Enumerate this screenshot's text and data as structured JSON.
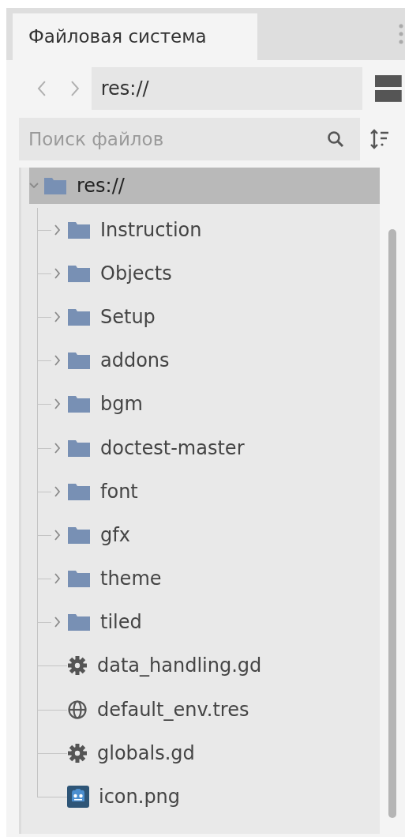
{
  "tabs": [
    {
      "label": "Файловая система",
      "selected": true
    }
  ],
  "path": {
    "value": "res://"
  },
  "search": {
    "placeholder": "Поиск файлов"
  },
  "tree": {
    "label": "res://",
    "kind": "folder",
    "expanded": true,
    "selected": true,
    "children": [
      {
        "label": "Instruction",
        "kind": "folder",
        "expanded": false
      },
      {
        "label": "Objects",
        "kind": "folder",
        "expanded": false
      },
      {
        "label": "Setup",
        "kind": "folder",
        "expanded": false
      },
      {
        "label": "addons",
        "kind": "folder",
        "expanded": false
      },
      {
        "label": "bgm",
        "kind": "folder",
        "expanded": false
      },
      {
        "label": "doctest-master",
        "kind": "folder",
        "expanded": false
      },
      {
        "label": "font",
        "kind": "folder",
        "expanded": false
      },
      {
        "label": "gfx",
        "kind": "folder",
        "expanded": false
      },
      {
        "label": "theme",
        "kind": "folder",
        "expanded": false
      },
      {
        "label": "tiled",
        "kind": "folder",
        "expanded": false
      },
      {
        "label": "data_handling.gd",
        "kind": "script"
      },
      {
        "label": "default_env.tres",
        "kind": "environment"
      },
      {
        "label": "globals.gd",
        "kind": "script"
      },
      {
        "label": "icon.png",
        "kind": "image"
      }
    ]
  }
}
